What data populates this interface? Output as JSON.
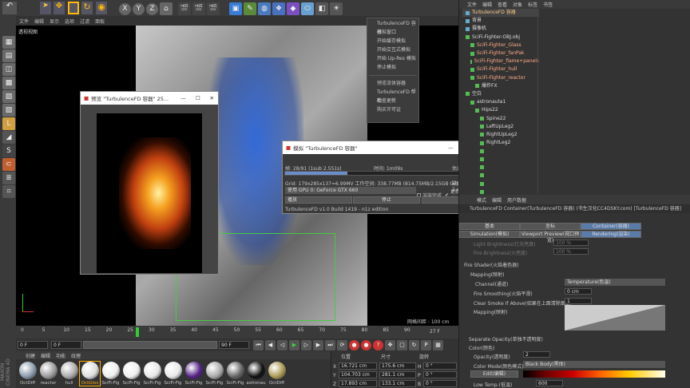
{
  "menu": [
    "文件",
    "编辑",
    "显示",
    "选项",
    "过滤",
    "面板"
  ],
  "viewport_label": "透视视图",
  "grid_spacing": "网格间距 : 100 cm",
  "toolbar_letters": [
    "X",
    "Y",
    "Z"
  ],
  "dropdown": {
    "items": [
      "TurbulenceFD 容器",
      "模拟窗口",
      "开始缓存模拟",
      "开始交互式模拟",
      "开始 Up-Res 模拟",
      "停止模拟",
      "",
      "预览流体容器",
      "TurbulenceFD 帮助",
      "检查更新",
      "购买许可证"
    ]
  },
  "preview": {
    "title": "预览 \"TurbulenceFD 容器\" 25..."
  },
  "sim": {
    "title": "模拟 \"TurbulenceFD 容器\"",
    "frame": "帧: 28/91 (1sub 2.551s)",
    "time": "时间: 1m09s",
    "eta": "估计时间: 3m33s",
    "grid": "Grid: 179x285x137=6.99MV  工作空间: 338.77MB (814.75MB/2.15GB GPU)",
    "disk": "磁盘缓存: 2.46GB",
    "gpu": "使用 GPU 0: GeForce GTX 660",
    "render_done": "渲染完成",
    "refresh": "更新编辑器时间线",
    "play": "播放",
    "stop": "停止",
    "close": "中止",
    "build": "TurbulenceFD v1.0 Build 1419 - n1z edition",
    "progress": 0.31
  },
  "obj_menu": [
    "文件",
    "编辑",
    "查看",
    "对象",
    "标签",
    "书签"
  ],
  "objects": [
    "TurbulenceFD 容器",
    "背景",
    "摄像机",
    "SciFi-Fighter-OBJ.obj",
    "SciFi-Fighter_Glass",
    "SciFi-Fighter_fanPak",
    "SciFi-Fighter_flame+panels",
    "SciFi-Fighter_hull",
    "SciFi-Fighter_reactor",
    "爆炸FX",
    "空白",
    "astronauta1",
    "Hips22",
    "Spine22",
    "LeftUpLeg2",
    "RightUpLeg2",
    "RightLeg2",
    "",
    "",
    "",
    "",
    "",
    "",
    ""
  ],
  "attr": {
    "tabs_top": [
      "模式",
      "编辑",
      "用户数据"
    ],
    "header": "TurbulenceFD Container(TurbulenceFD 容器) (书生汉化CC4DSKY.com) [TurbulenceFD 容器]",
    "tabs1": [
      "基本",
      "坐标",
      "Container(容器)"
    ],
    "tabs2": [
      "Simulation(模拟)",
      "Viewport Preview(视口预览)",
      "Rendering(渲染)"
    ],
    "light1": "Light Brightness(灯光亮度)",
    "light2": "Fire Brightness(火亮度)",
    "light_val": "100 %",
    "fire_shader": "Fire Shader(火焰着色器)",
    "mapping": "Mapping(映射)",
    "channel": "Channel(通道)",
    "channel_val": "Temperature(色温)",
    "smoothing": "Fire Smoothing(火焰平滑)",
    "smoothing_val": "0 cm",
    "clear": "Clear Smoke If Above(如果在上面清除烟雾)",
    "clear_val": "1",
    "mapping2": "Mapping(映射)",
    "sep": "Separate Opacity(单独不透明度)",
    "color": "Color(颜色)",
    "opacity": "Opacity(透明度)",
    "opacity_val": "2",
    "color_mode": "Color Mode(颜色模式)",
    "color_mode_val": "Black Body(黑体)",
    "edit": "Edit(编辑)",
    "low_temp": "Low Temp.(低温)",
    "low_temp_val": "600"
  },
  "timeline": {
    "ticks": [
      "0",
      "5",
      "10",
      "15",
      "20",
      "25",
      "30",
      "35",
      "40",
      "45",
      "50",
      "55",
      "60",
      "65",
      "70",
      "75",
      "80",
      "85",
      "90"
    ],
    "current": "27 F",
    "start": "0 F",
    "end": "90 F",
    "max": "90 F",
    "field0": "0 F"
  },
  "mats": {
    "tabs": [
      "创建",
      "编辑",
      "功能",
      "纹理"
    ],
    "labels": [
      "OctDiff",
      "reactor",
      "hull",
      "OctGlos",
      "SciFi-Fig",
      "SciFi-Fig",
      "SciFi-Fig",
      "SciFi-Fig",
      "SciFi-Fig",
      "SciFi-Fig",
      "SciFi-Fig",
      "astronau",
      "OctDiff"
    ],
    "colors": [
      "#8899aa",
      "#999",
      "#aaa",
      "#ddd",
      "#eee",
      "#eee",
      "#e8e8e8",
      "#e8e8e8",
      "#552288",
      "#aaa",
      "#666",
      "#111",
      "#aa9955"
    ]
  },
  "coords": {
    "headers": [
      "位置",
      "尺寸",
      "旋转"
    ],
    "pos": [
      "16.721 cm",
      "104.703 cm",
      "17.893 cm"
    ],
    "size": [
      "175.6 cm",
      "281.1 cm",
      "133.1 cm"
    ],
    "rot": [
      "0 °",
      "0 °",
      "0 °"
    ],
    "axes_pos": [
      "X",
      "Y",
      "Z"
    ],
    "axes_rot": [
      "H",
      "P",
      "B"
    ]
  },
  "brand": "MAXON CINEMA 4D"
}
